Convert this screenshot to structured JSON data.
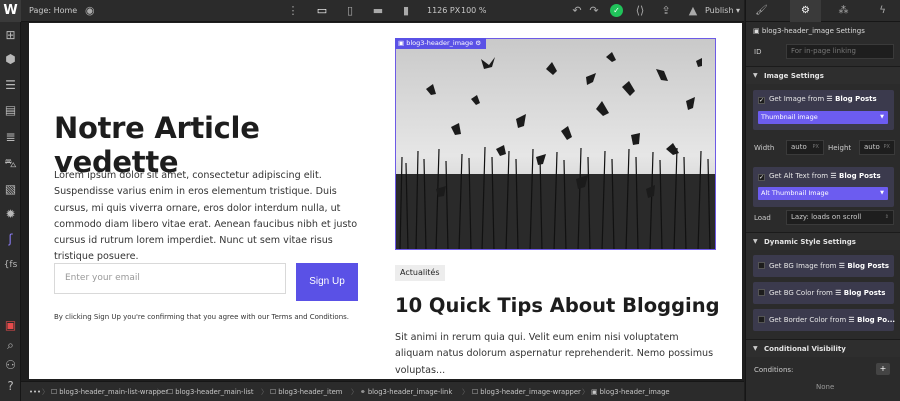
{
  "topbar": {
    "page_label": "Page: Home",
    "canvas_width": "1126 PX",
    "zoom": "100 %",
    "publish_label": "Publish ▾"
  },
  "canvas": {
    "headline": "Notre Article vedette",
    "lede": "Lorem ipsum dolor sit amet, consectetur adipiscing elit. Suspendisse varius enim in eros elementum tristique. Duis cursus, mi quis viverra ornare, eros dolor interdum nulla, ut commodo diam libero vitae erat. Aenean faucibus nibh et justo cursus id rutrum lorem imperdiet. Nunc ut sem vitae risus tristique posuere.",
    "email_placeholder": "Enter your email",
    "signup_label": "Sign Up",
    "disclaimer": "By clicking Sign Up you're confirming that you agree with our Terms and Conditions.",
    "image_tag": "blog3-header_image",
    "category": "Actualités",
    "post_title": "10 Quick Tips About Blogging",
    "post_excerpt": "Sit animi in rerum quia qui. Velit eum enim nisi voluptatem aliquam natus dolorum aspernatur reprehenderit. Nemo possimus voluptas..."
  },
  "breadcrumbs": {
    "more": "•••",
    "items": [
      "blog3-header_main-list-wrapper",
      "blog3-header_main-list",
      "blog3-header_item",
      "blog3-header_image-link",
      "blog3-header_image-wrapper",
      "blog3-header_image"
    ]
  },
  "panel": {
    "element_name": "blog3-header_image Settings",
    "id_label": "ID",
    "id_placeholder": "For in-page linking",
    "image_settings": {
      "title": "Image Settings",
      "get_image_prefix": "Get Image from",
      "get_image_source": "☰ Blog Posts",
      "image_field": "Thumbnail image",
      "width_label": "Width",
      "width_value": "auto",
      "width_unit": "PX",
      "height_label": "Height",
      "height_value": "auto",
      "height_unit": "PX",
      "alt_prefix": "Get Alt Text from",
      "alt_source": "☰ Blog Posts",
      "alt_field": "Alt Thumbnail Image",
      "load_label": "Load",
      "load_value": "Lazy: loads on scroll"
    },
    "dynamic_style": {
      "title": "Dynamic Style Settings",
      "bg_image_prefix": "Get BG Image from",
      "bg_image_source": "☰ Blog Posts",
      "bg_color_prefix": "Get BG Color from",
      "bg_color_source": "☰ Blog Posts",
      "border_color_prefix": "Get Border Color from",
      "border_color_source": "☰ Blog Po..."
    },
    "conditional": {
      "title": "Conditional Visibility",
      "conditions_label": "Conditions:",
      "conditions_value": "None"
    }
  },
  "colors": {
    "accent": "#5a51e6",
    "panel_bg": "#2b2b2b",
    "success": "#20c35a"
  }
}
